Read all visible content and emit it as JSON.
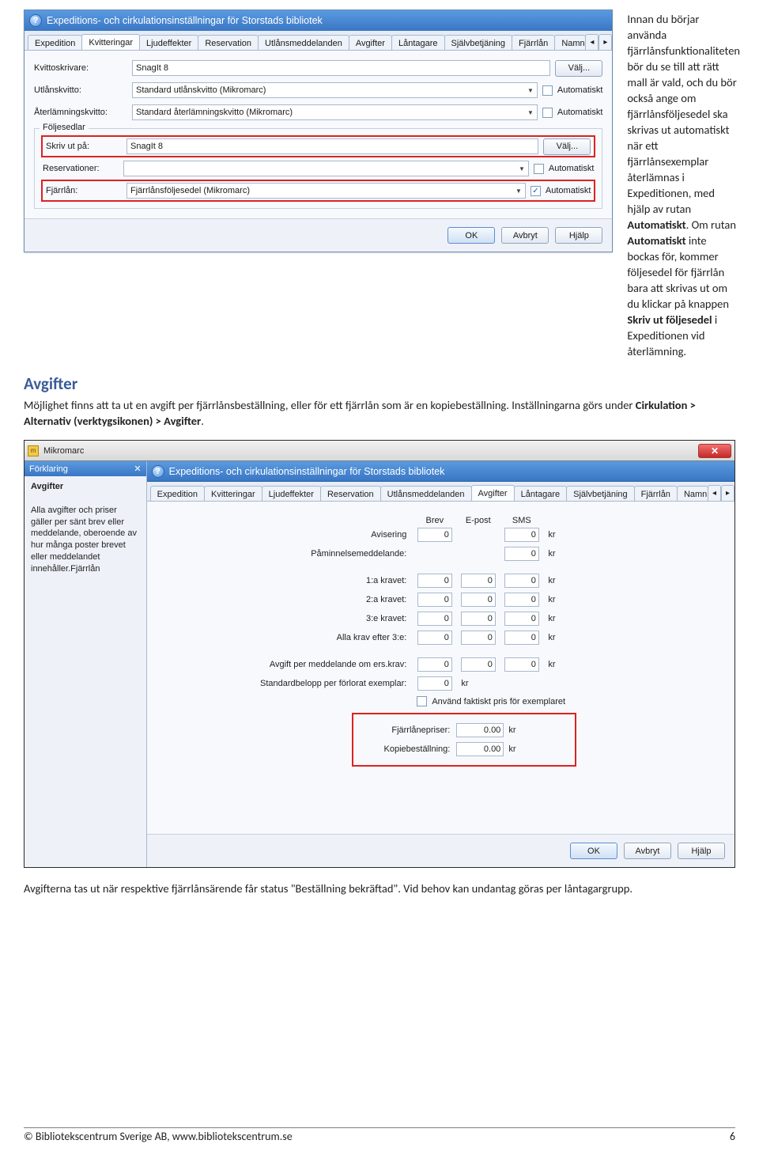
{
  "top_dialog": {
    "title": "Expeditions- och cirkulationsinställningar för Storstads bibliotek",
    "tabs": [
      "Expedition",
      "Kvitteringar",
      "Ljudeffekter",
      "Reservation",
      "Utlånsmeddelanden",
      "Avgifter",
      "Låntagare",
      "Självbetjäning",
      "Fjärrlån",
      "Namn"
    ],
    "selected_tab_index": 1,
    "fields": {
      "kvittoskrivare_label": "Kvittoskrivare:",
      "kvittoskrivare_value": "SnagIt 8",
      "valj_button": "Välj...",
      "utlanskvitto_label": "Utlånskvitto:",
      "utlanskvitto_value": "Standard utlånskvitto (Mikromarc)",
      "aterlamningskvitto_label": "Återlämningskvitto:",
      "aterlamningskvitto_value": "Standard återlämningskvitto (Mikromarc)",
      "automatiskt_label": "Automatiskt"
    },
    "foljesedlar": {
      "group_label": "Följesedlar",
      "skriv_ut_pa_label": "Skriv ut på:",
      "skriv_ut_pa_value": "SnagIt 8",
      "valj_button": "Välj...",
      "reservationer_label": "Reservationer:",
      "fjarrlan_label": "Fjärrlån:",
      "fjarrlan_value": "Fjärrlånsföljesedel (Mikromarc)",
      "automatiskt_label": "Automatiskt"
    },
    "buttons": {
      "ok": "OK",
      "avbryt": "Avbryt",
      "hjalp": "Hjälp"
    }
  },
  "top_text": {
    "t1a": "Innan du börjar använda fjärrlånsfunktionaliteten bör du se till att rätt mall är vald, och du bör också ange om fjärrlånsföljesedel ska skrivas ut automatiskt när ett fjärrlånsexemplar återlämnas i Expeditionen, med hjälp av rutan ",
    "t1b": "Automatiskt",
    "t1c": ". Om rutan ",
    "t1d": "Automatiskt",
    "t1e": " inte bockas för, kommer följesedel för fjärrlån bara att skrivas ut om du klickar på knappen ",
    "t1f": "Skriv ut följesedel",
    "t1g": " i Expeditionen vid återlämning."
  },
  "section_avgifter": {
    "title": "Avgifter",
    "p1a": "Möjlighet finns att ta ut en avgift per fjärrlånsbeställning, eller för ett fjärrlån som är en kopiebeställning. Inställningarna görs under ",
    "p1b": "Cirkulation > Alternativ (verktygsikonen) > Avgifter",
    "p1c": "."
  },
  "mikromarc": {
    "app_title": "Mikromarc",
    "side_header": "Förklaring",
    "side_heading": "Avgifter",
    "side_body": "Alla avgifter och priser gäller per sänt brev eller meddelande, oberoende av hur många poster brevet eller meddelandet innehåller.Fjärrlån",
    "dialog_title": "Expeditions- och cirkulationsinställningar för Storstads bibliotek",
    "tabs": [
      "Expedition",
      "Kvitteringar",
      "Ljudeffekter",
      "Reservation",
      "Utlånsmeddelanden",
      "Avgifter",
      "Låntagare",
      "Självbetjäning",
      "Fjärrlån",
      "Namn"
    ],
    "selected_tab_index": 5,
    "columns": {
      "brev": "Brev",
      "epost": "E-post",
      "sms": "SMS"
    },
    "rows": {
      "avisering": {
        "label": "Avisering",
        "brev": "0",
        "sms": "0"
      },
      "paminnelse": {
        "label": "Påminnelsemeddelande:",
        "sms": "0"
      },
      "krav1": {
        "label": "1:a kravet:",
        "brev": "0",
        "epost": "0",
        "sms": "0"
      },
      "krav2": {
        "label": "2:a kravet:",
        "brev": "0",
        "epost": "0",
        "sms": "0"
      },
      "krav3": {
        "label": "3:e kravet:",
        "brev": "0",
        "epost": "0",
        "sms": "0"
      },
      "efter3": {
        "label": "Alla krav efter 3:e:",
        "brev": "0",
        "epost": "0",
        "sms": "0"
      },
      "erskrav": {
        "label": "Avgift per meddelande om ers.krav:",
        "brev": "0",
        "epost": "0",
        "sms": "0"
      },
      "std": {
        "label": "Standardbelopp per förlorat exemplar:",
        "brev": "0"
      }
    },
    "kr": "kr",
    "anvand_faktiskt": "Använd faktiskt pris för exemplaret",
    "fjarrlanepriser": {
      "label": "Fjärrlånepriser:",
      "value": "0.00"
    },
    "kopiebestallning": {
      "label": "Kopiebeställning:",
      "value": "0.00"
    },
    "buttons": {
      "ok": "OK",
      "avbryt": "Avbryt",
      "hjalp": "Hjälp"
    }
  },
  "closing_para": "Avgifterna tas ut när respektive fjärrlånsärende får status \"Beställning bekräftad\". Vid behov kan undantag göras per låntagargrupp.",
  "footer": {
    "copy": "© Bibliotekscentrum Sverige AB, www.bibliotekscentrum.se",
    "page": "6"
  }
}
